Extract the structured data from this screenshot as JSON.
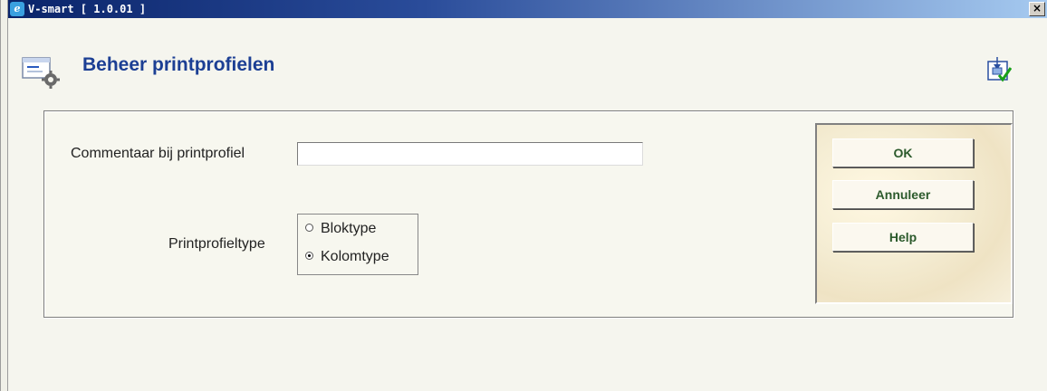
{
  "window": {
    "title": "V-smart [ 1.0.01 ]",
    "close_glyph": "×"
  },
  "header": {
    "title": "Beheer printprofielen",
    "icon": "printprofile-settings-icon",
    "action_icon": "confirm-icon"
  },
  "form": {
    "comment_label": "Commentaar bij printprofiel",
    "comment_value": "",
    "type_label": "Printprofieltype",
    "type_options": [
      {
        "label": "Bloktype",
        "selected": false
      },
      {
        "label": "Kolomtype",
        "selected": true
      }
    ]
  },
  "buttons": {
    "ok": "OK",
    "cancel": "Annuleer",
    "help": "Help"
  },
  "colors": {
    "title_text": "#1c3f94",
    "button_text": "#2c5a2c",
    "titlebar": "#0a246a"
  }
}
